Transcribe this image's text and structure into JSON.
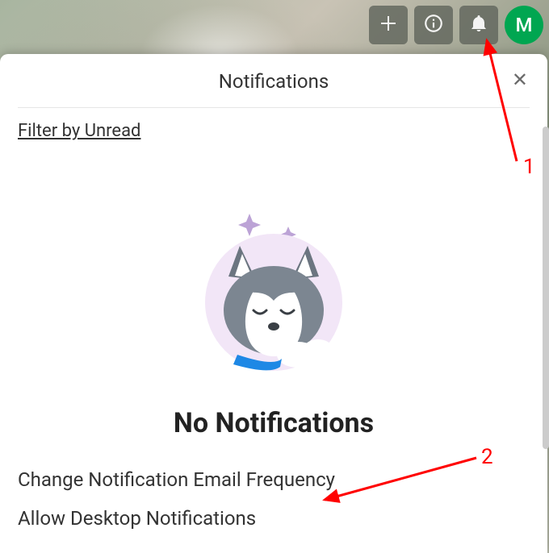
{
  "header": {
    "avatar_letter": "M"
  },
  "panel": {
    "title": "Notifications",
    "filter_link": "Filter by Unread",
    "empty": {
      "title": "No Notifications",
      "link_email": "Change Notification Email Frequency",
      "link_desktop": "Allow Desktop Notifications"
    }
  },
  "annotations": {
    "one": "1",
    "two": "2"
  },
  "colors": {
    "accent_green": "#00a651",
    "annotation_red": "#ff0000"
  }
}
